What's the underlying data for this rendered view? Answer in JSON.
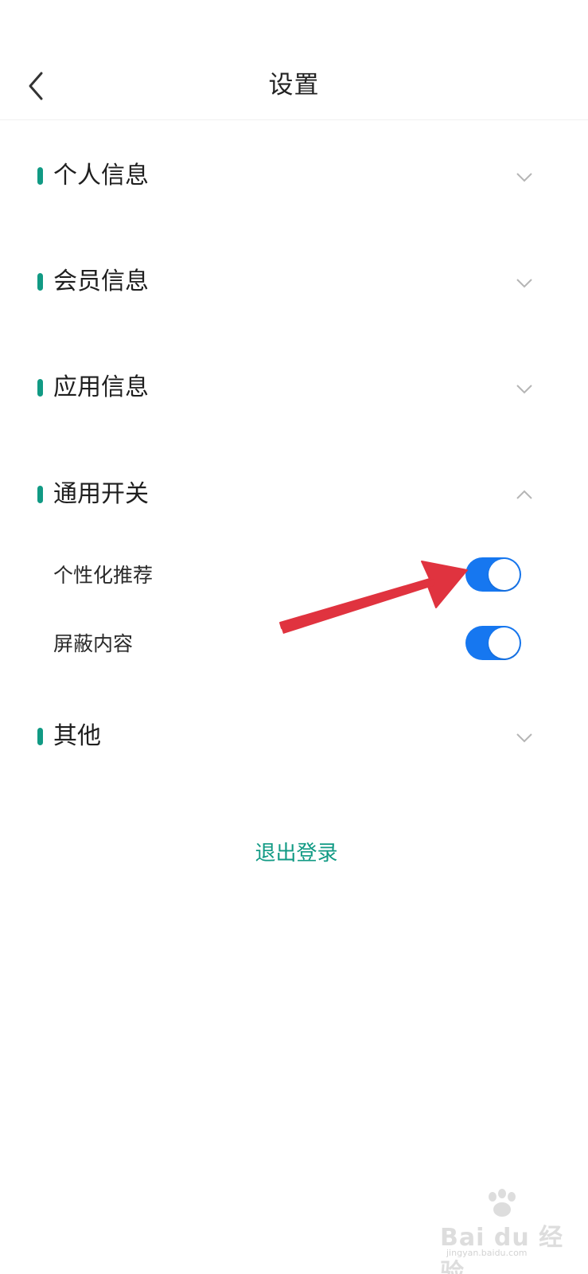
{
  "header": {
    "title": "设置",
    "back_icon": "chevron-left-icon"
  },
  "sections": [
    {
      "label": "个人信息",
      "state": "collapsed",
      "icon": "chevron-down-icon"
    },
    {
      "label": "会员信息",
      "state": "collapsed",
      "icon": "chevron-down-icon"
    },
    {
      "label": "应用信息",
      "state": "collapsed",
      "icon": "chevron-down-icon"
    },
    {
      "label": "通用开关",
      "state": "expanded",
      "icon": "chevron-up-icon"
    },
    {
      "label": "其他",
      "state": "collapsed",
      "icon": "chevron-down-icon"
    }
  ],
  "general_switches": [
    {
      "label": "个性化推荐",
      "on": true
    },
    {
      "label": "屏蔽内容",
      "on": true
    }
  ],
  "logout_label": "退出登录",
  "colors": {
    "accent": "#119a84",
    "switch_on": "#1677f0",
    "annotation_arrow": "#e0333f",
    "text_primary": "#1f1f1f",
    "chevron": "#b5b5b5"
  },
  "watermark": {
    "text": "Bai du 经验",
    "subtext": "jingyan.baidu.com"
  }
}
